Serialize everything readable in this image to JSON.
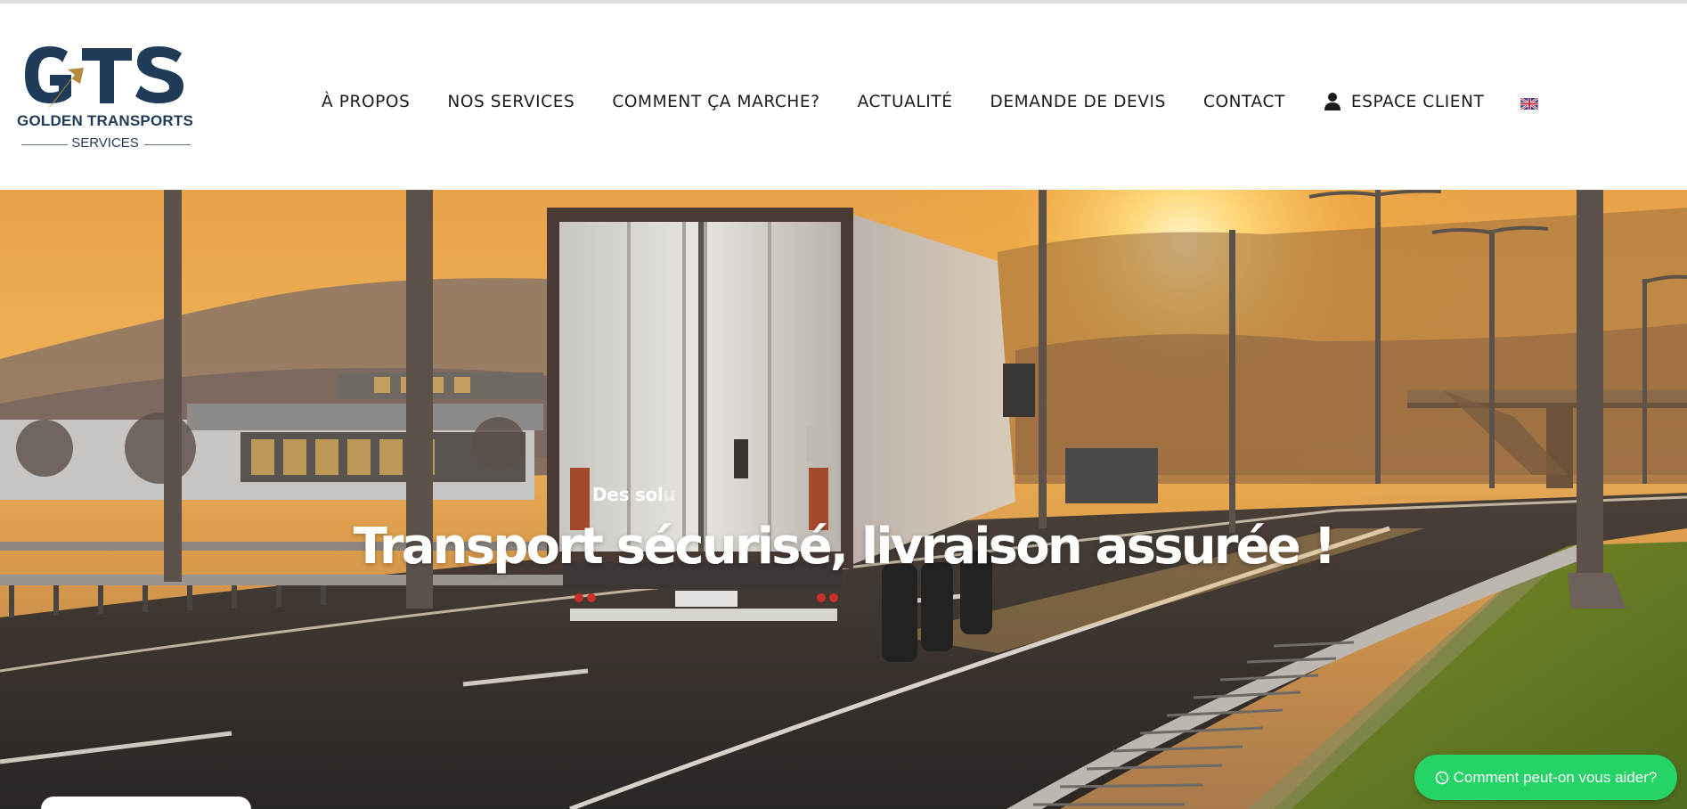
{
  "brand": {
    "name": "GOLDEN TRANSPORTS",
    "tagline": "SERVICES",
    "monogram": "GTS",
    "colors": {
      "navy": "#1f3b57",
      "gold": "#b48a3c"
    }
  },
  "nav": {
    "items": [
      {
        "label": "À PROPOS"
      },
      {
        "label": "NOS SERVICES"
      },
      {
        "label": "COMMENT ÇA MARCHE?"
      },
      {
        "label": "ACTUALITÉ"
      },
      {
        "label": "DEMANDE DE DEVIS"
      },
      {
        "label": "CONTACT"
      }
    ],
    "client_area": {
      "label": "ESPACE CLIENT",
      "icon": "user-icon"
    },
    "language": {
      "icon": "uk-flag-icon"
    }
  },
  "hero": {
    "subtitle_visible": "Des sol",
    "subtitle_faded": "u",
    "title": "Transport sécurisé, livraison assurée !"
  },
  "whatsapp": {
    "label": "Comment peut-on vous aider?",
    "icon": "whatsapp-icon",
    "color": "#25d366"
  }
}
